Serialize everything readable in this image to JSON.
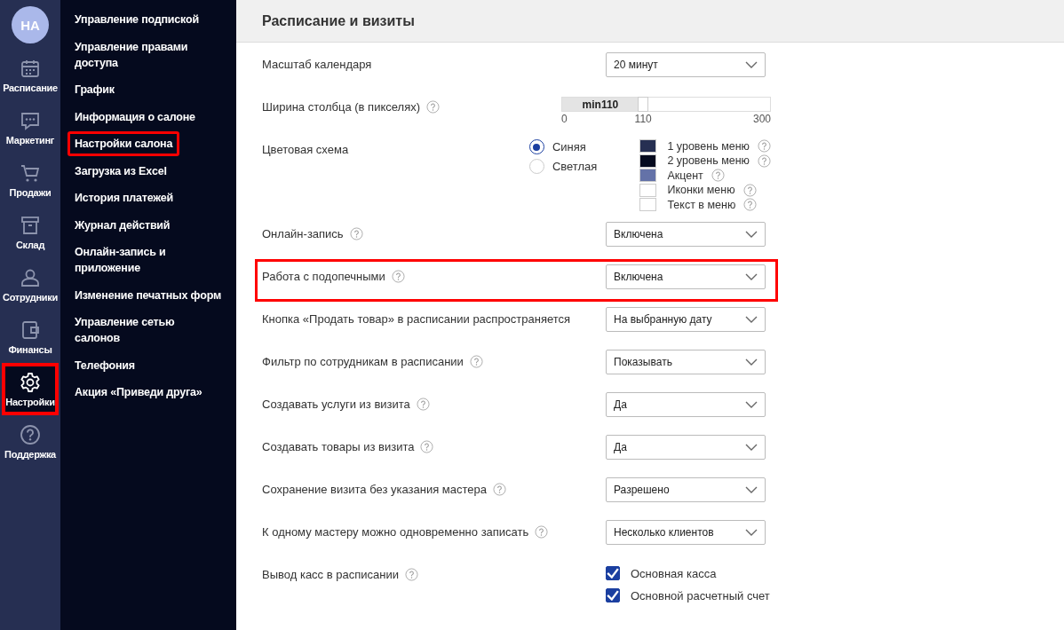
{
  "rail": {
    "avatar": "НА",
    "items": [
      {
        "label": "Расписание",
        "selected": false,
        "highlighted": false
      },
      {
        "label": "Маркетинг",
        "selected": false,
        "highlighted": false
      },
      {
        "label": "Продажи",
        "selected": false,
        "highlighted": false
      },
      {
        "label": "Склад",
        "selected": false,
        "highlighted": false
      },
      {
        "label": "Сотрудники",
        "selected": false,
        "highlighted": false
      },
      {
        "label": "Финансы",
        "selected": false,
        "highlighted": false
      },
      {
        "label": "Настройки",
        "selected": true,
        "highlighted": true
      },
      {
        "label": "Поддержка",
        "selected": false,
        "highlighted": false
      }
    ]
  },
  "submenu": {
    "items": [
      {
        "label": "Управление подпиской",
        "highlighted": false
      },
      {
        "label": "Управление правами доступа",
        "highlighted": false
      },
      {
        "label": "График",
        "highlighted": false
      },
      {
        "label": "Информация о салоне",
        "highlighted": false
      },
      {
        "label": "Настройки салона",
        "highlighted": true
      },
      {
        "label": "Загрузка из Excel",
        "highlighted": false
      },
      {
        "label": "История платежей",
        "highlighted": false
      },
      {
        "label": "Журнал действий",
        "highlighted": false
      },
      {
        "label": "Онлайн-запись и приложение",
        "highlighted": false
      },
      {
        "label": "Изменение печатных форм",
        "highlighted": false
      },
      {
        "label": "Управление сетью салонов",
        "highlighted": false
      },
      {
        "label": "Телефония",
        "highlighted": false
      },
      {
        "label": "Акция «Приведи друга»",
        "highlighted": false
      }
    ]
  },
  "section": {
    "title": "Расписание и визиты",
    "settings": [
      {
        "kind": "select",
        "label": "Масштаб календаря",
        "help": false,
        "highlighted": false,
        "value": "20 минут"
      },
      {
        "kind": "slider",
        "label": "Ширина столбца (в пикселях)",
        "help": true,
        "highlighted": false,
        "fill_label": "min110",
        "level": 0.367,
        "ticks": [
          "0",
          "110",
          "300"
        ]
      },
      {
        "kind": "scheme",
        "label": "Цветовая схема",
        "help": false,
        "highlighted": false,
        "options": [
          {
            "label": "Синяя",
            "selected": true
          },
          {
            "label": "Светлая",
            "selected": false
          }
        ],
        "swatches": [
          {
            "label": "1 уровень меню",
            "color": "#262f52"
          },
          {
            "label": "2 уровень меню",
            "color": "#050a1e"
          },
          {
            "label": "Акцент",
            "color": "#6472a8"
          },
          {
            "label": "Иконки меню",
            "color": "#ffffff"
          },
          {
            "label": "Текст в меню",
            "color": "#ffffff"
          }
        ]
      },
      {
        "kind": "select",
        "label": "Онлайн-запись",
        "help": true,
        "highlighted": false,
        "value": "Включена"
      },
      {
        "kind": "select",
        "label": "Работа с подопечными",
        "help": true,
        "highlighted": true,
        "value": "Включена"
      },
      {
        "kind": "select",
        "label": "Кнопка «Продать товар» в расписании распространяется",
        "help": false,
        "highlighted": false,
        "value": "На выбранную дату"
      },
      {
        "kind": "select",
        "label": "Фильтр по сотрудникам в расписании",
        "help": true,
        "highlighted": false,
        "value": "Показывать"
      },
      {
        "kind": "select",
        "label": "Создавать услуги из визита",
        "help": true,
        "highlighted": false,
        "value": "Да"
      },
      {
        "kind": "select",
        "label": "Создавать товары из визита",
        "help": true,
        "highlighted": false,
        "value": "Да"
      },
      {
        "kind": "select",
        "label": "Сохранение визита без указания мастера",
        "help": true,
        "highlighted": false,
        "value": "Разрешено"
      },
      {
        "kind": "select",
        "label": "К одному мастеру можно одновременно записать",
        "help": true,
        "highlighted": false,
        "value": "Несколько клиентов"
      },
      {
        "kind": "checks",
        "label": "Вывод касс в расписании",
        "help": true,
        "highlighted": false,
        "items": [
          {
            "label": "Основная касса",
            "checked": true
          },
          {
            "label": "Основной расчетный счет",
            "checked": true
          }
        ]
      }
    ]
  }
}
